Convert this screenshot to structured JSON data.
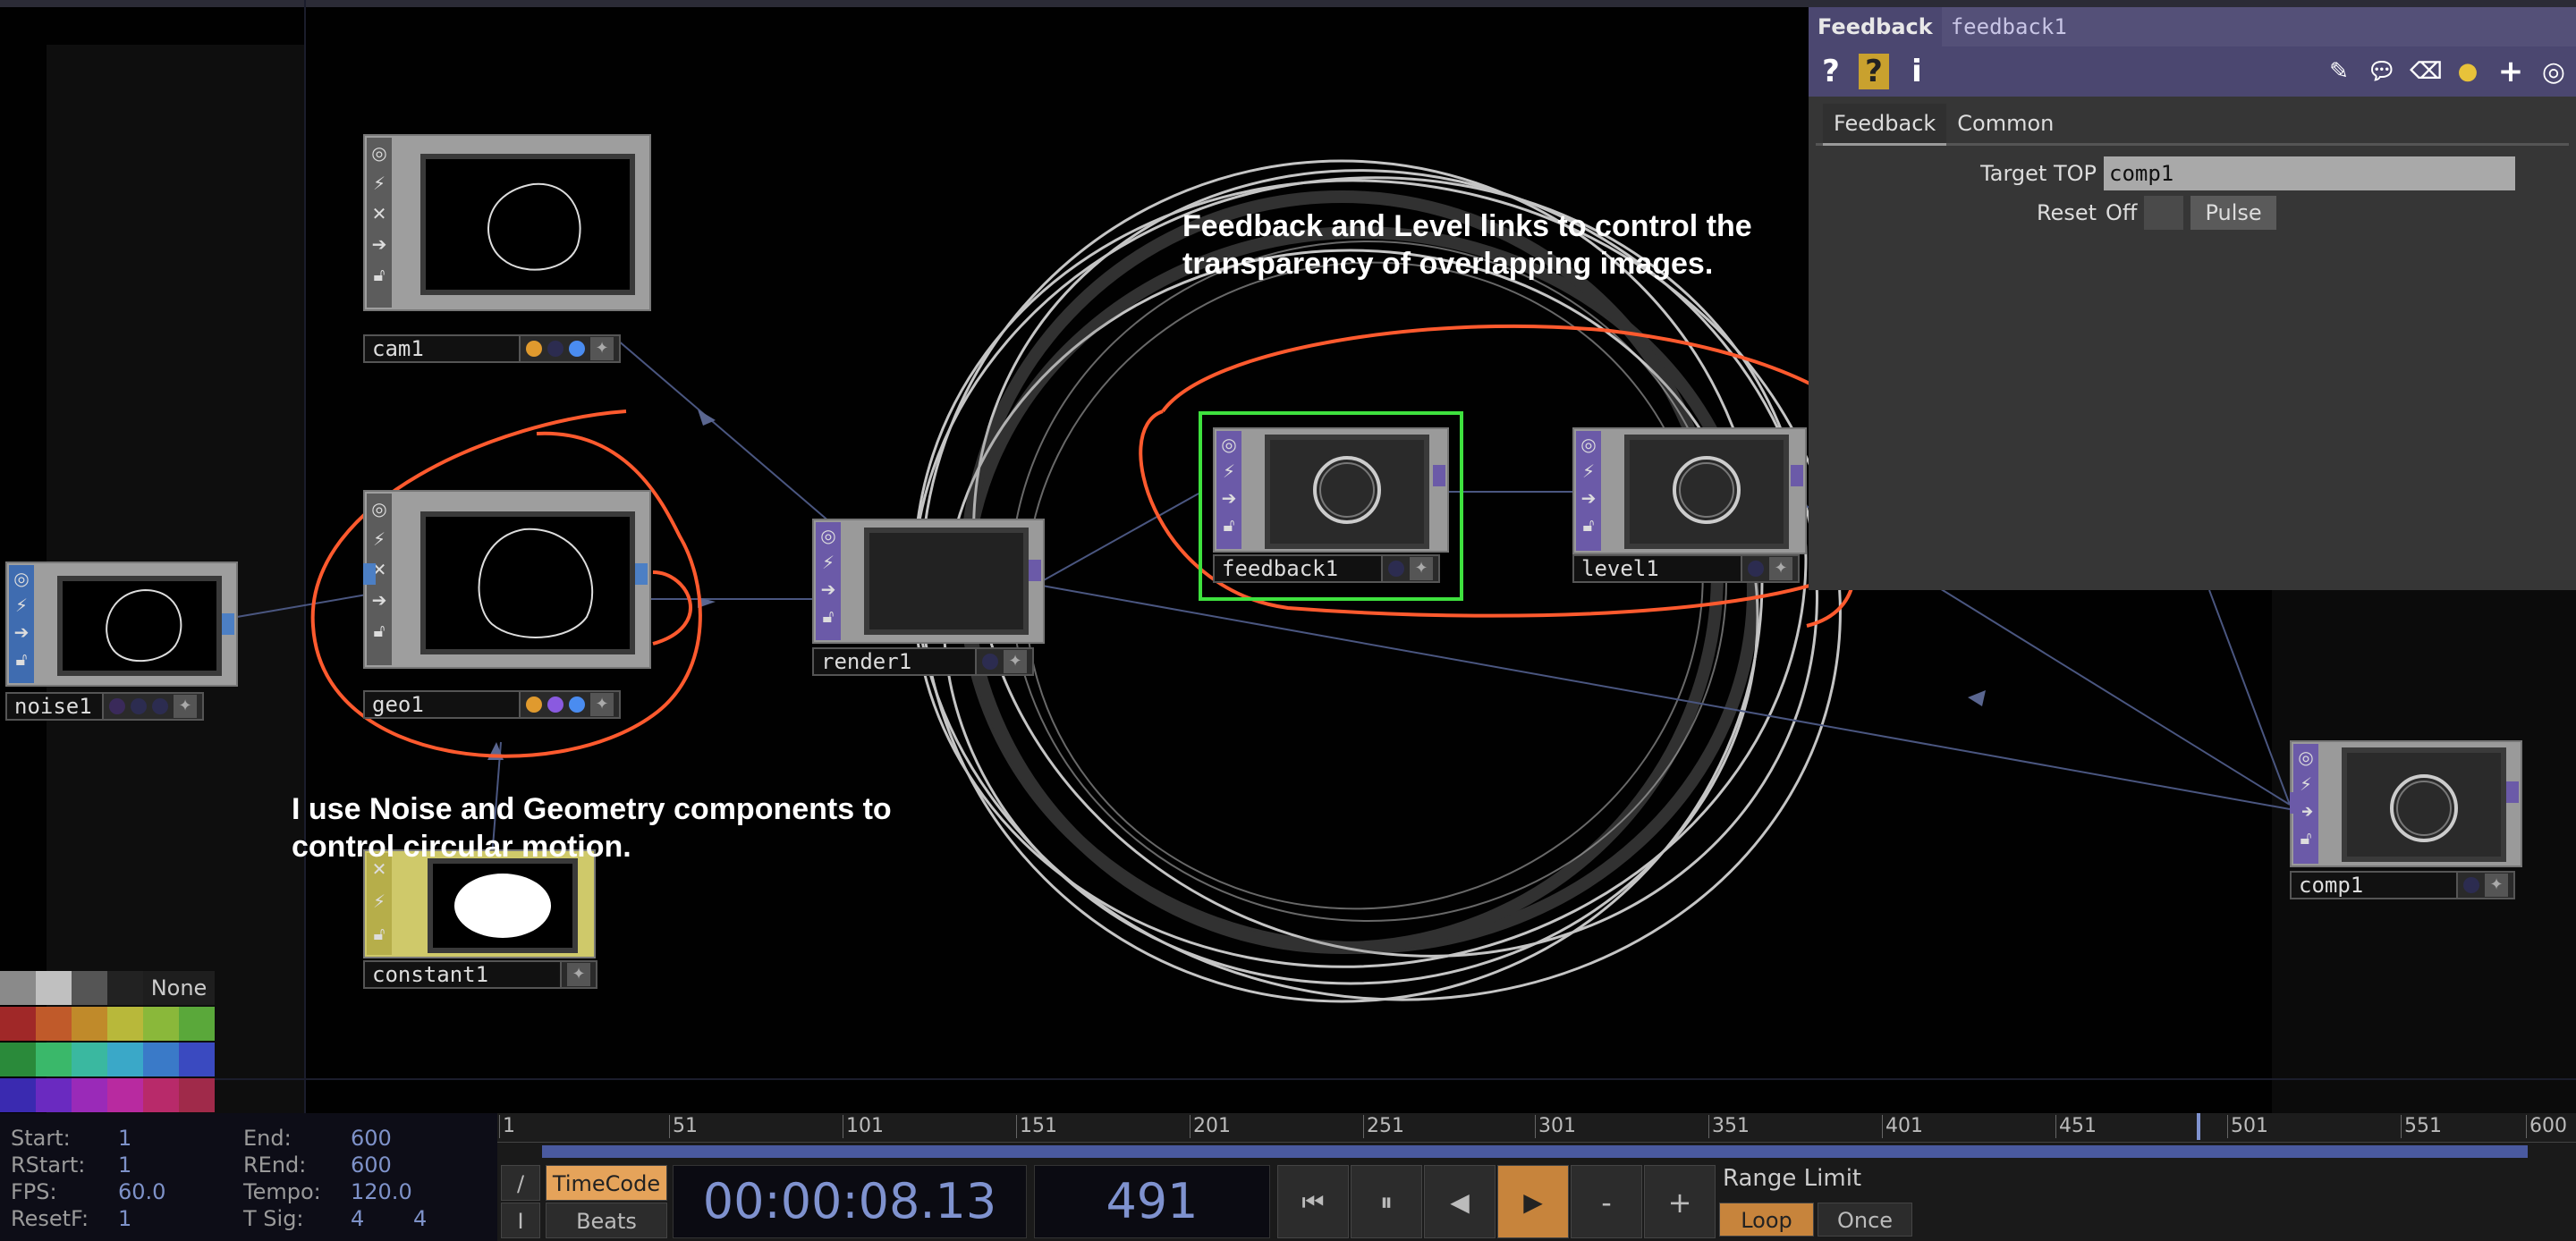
{
  "nodes": {
    "cam1": {
      "label": "cam1"
    },
    "geo1": {
      "label": "geo1"
    },
    "noise1": {
      "label": "noise1"
    },
    "render1": {
      "label": "render1"
    },
    "constant1": {
      "label": "constant1"
    },
    "feedback1": {
      "label": "feedback1"
    },
    "level1": {
      "label": "level1"
    },
    "comp1": {
      "label": "comp1"
    }
  },
  "annotations": {
    "top": "Feedback and Level links to control the transparency of overlapping images.",
    "bottom": "I use Noise and Geometry components to control circular motion."
  },
  "palette": {
    "none_label": "None"
  },
  "param_panel": {
    "op_type": "Feedback",
    "op_name": "feedback1",
    "tabs": [
      "Feedback",
      "Common"
    ],
    "target_top_label": "Target TOP",
    "target_top_value": "comp1",
    "reset_label": "Reset",
    "reset_value": "Off",
    "pulse_label": "Pulse"
  },
  "timeline": {
    "ticks": [
      "1",
      "51",
      "101",
      "151",
      "201",
      "251",
      "301",
      "351",
      "401",
      "451",
      "501",
      "551",
      "600"
    ],
    "start_label": "Start:",
    "start": "1",
    "rstart_label": "RStart:",
    "rstart": "1",
    "fps_label": "FPS:",
    "fps": "60.0",
    "resetf_label": "ResetF:",
    "resetf": "1",
    "end_label": "End:",
    "end": "600",
    "rend_label": "REnd:",
    "rend": "600",
    "tempo_label": "Tempo:",
    "tempo": "120.0",
    "tsig_label": "T Sig:",
    "tsig_a": "4",
    "tsig_b": "4",
    "timecode_label": "TimeCode",
    "beats_label": "Beats",
    "timecode": "00:00:08.13",
    "frame": "491",
    "range_limit_label": "Range Limit",
    "loop_label": "Loop",
    "once_label": "Once",
    "minus": "-",
    "plus": "+",
    "slash": "/",
    "bar": "I"
  }
}
